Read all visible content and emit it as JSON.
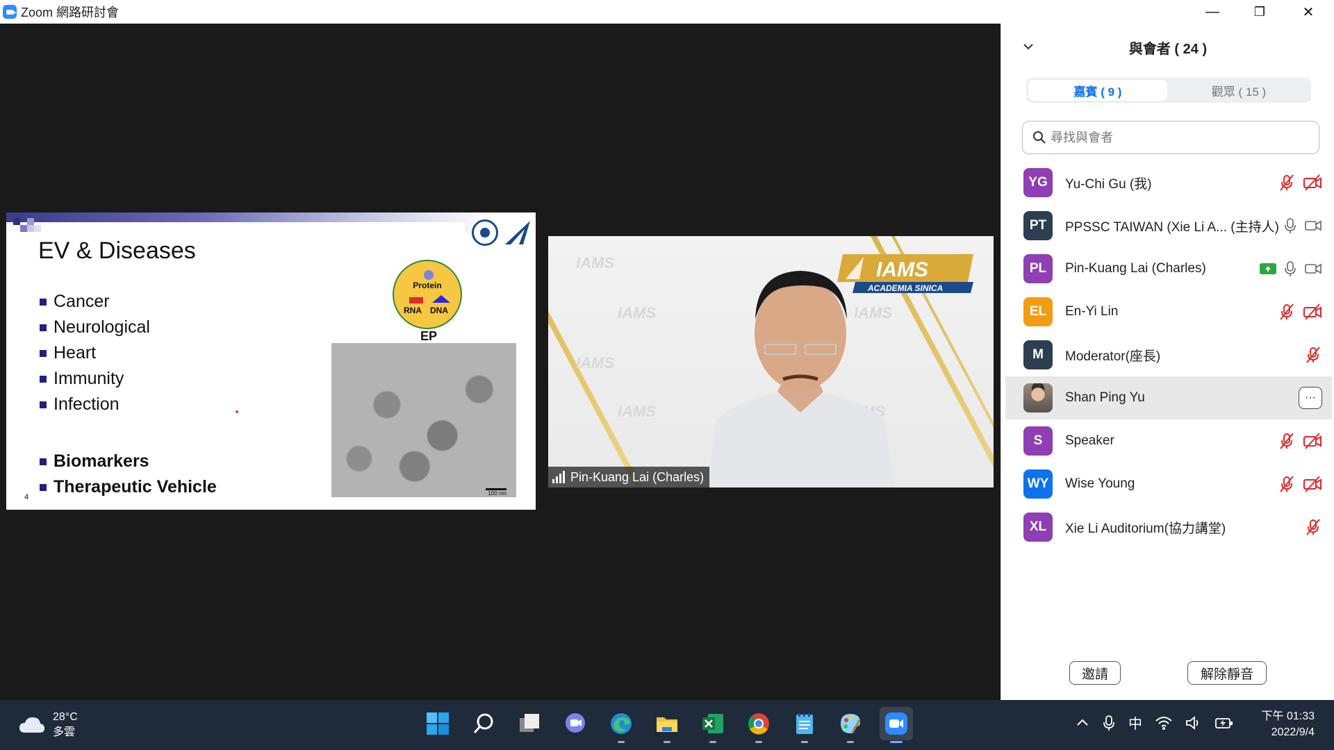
{
  "window": {
    "title": "Zoom 網路研討會",
    "minimize": "—",
    "restore": "❐",
    "close": "✕"
  },
  "slide": {
    "title": "EV & Diseases",
    "bullets": [
      "Cancer",
      "Neurological",
      "Heart",
      "Immunity",
      "Infection"
    ],
    "bold_bullets": [
      "Biomarkers",
      "Therapeutic Vehicle"
    ],
    "page_number": "4",
    "diagram": {
      "protein": "Protein",
      "rna": "RNA",
      "dna": "DNA",
      "label": "EP"
    },
    "scale_bar": "100 nm"
  },
  "video": {
    "speaker_name": "Pin-Kuang Lai (Charles)",
    "banner_title": "IAMS",
    "banner_subtitle": "ACADEMIA SINICA",
    "watermark": "IAMS"
  },
  "panel": {
    "title": "與會者 ( 24 )",
    "tab_panelists": "嘉賓 ( 9 )",
    "tab_attendees": "觀眾 ( 15 )",
    "search_placeholder": "尋找與會者",
    "participants": [
      {
        "initials": "YG",
        "name": "Yu-Chi Gu (我)",
        "color": "#8e3fb4",
        "mic": "muted",
        "video": "off"
      },
      {
        "initials": "PT",
        "name": "PPSSC TAIWAN (Xie Li A... (主持人)",
        "color": "#2c3e50",
        "mic": "on",
        "video": "on"
      },
      {
        "initials": "PL",
        "name": "Pin-Kuang Lai (Charles)",
        "color": "#8e3fb4",
        "mic": "on",
        "video": "on",
        "sharing": true
      },
      {
        "initials": "EL",
        "name": "En-Yi Lin",
        "color": "#f39c12",
        "mic": "muted",
        "video": "off"
      },
      {
        "initials": "M",
        "name": "Moderator(座長)",
        "color": "#2c3e50",
        "mic": "muted"
      },
      {
        "initials": "",
        "name": "Shan Ping Yu",
        "photo": true,
        "more": "···"
      },
      {
        "initials": "S",
        "name": "Speaker",
        "color": "#8e3fb4",
        "mic": "muted",
        "video": "off"
      },
      {
        "initials": "WY",
        "name": "Wise Young",
        "color": "#0e72ed",
        "mic": "muted",
        "video": "off"
      },
      {
        "initials": "XL",
        "name": "Xie Li Auditorium(協力講堂)",
        "color": "#8e3fb4",
        "mic": "muted"
      }
    ],
    "invite_button": "邀請",
    "unmute_button": "解除靜音"
  },
  "taskbar": {
    "temperature": "28°C",
    "weather": "多雲",
    "ime": "中",
    "time": "下午 01:33",
    "date": "2022/9/4"
  }
}
